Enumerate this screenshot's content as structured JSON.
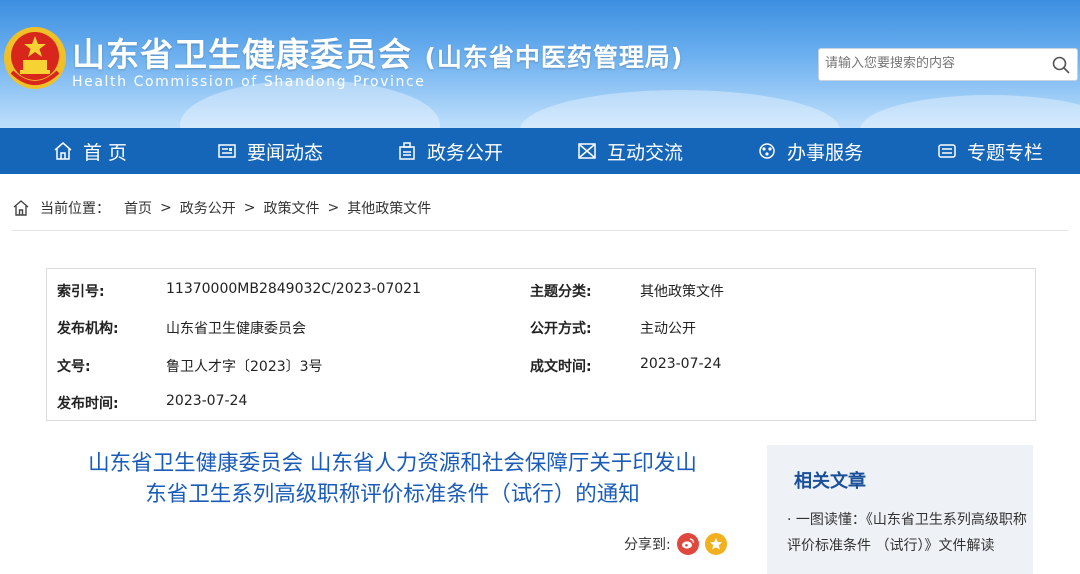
{
  "header": {
    "title": "山东省卫生健康委员会",
    "title_suffix": "(山东省中医药管理局)",
    "subtitle": "Health Commission of Shandong Province",
    "search_placeholder": "请输入您要搜索的内容"
  },
  "nav": {
    "items": [
      {
        "label": "首 页",
        "icon": "home-icon"
      },
      {
        "label": "要闻动态",
        "icon": "news-icon"
      },
      {
        "label": "政务公开",
        "icon": "government-icon"
      },
      {
        "label": "互动交流",
        "icon": "interaction-icon"
      },
      {
        "label": "办事服务",
        "icon": "service-icon"
      },
      {
        "label": "专题专栏",
        "icon": "column-icon"
      }
    ]
  },
  "breadcrumb": {
    "label": "当前位置：",
    "items": [
      "首页",
      "政务公开",
      "政策文件",
      "其他政策文件"
    ],
    "separator": ">"
  },
  "info": {
    "index_label": "索引号:",
    "index_value": "11370000MB2849032C/2023-07021",
    "topic_label": "主题分类:",
    "topic_value": "其他政策文件",
    "org_label": "发布机构:",
    "org_value": "山东省卫生健康委员会",
    "mode_label": "公开方式:",
    "mode_value": "主动公开",
    "doc_label": "文号:",
    "doc_value": "鲁卫人才字〔2023〕3号",
    "made_label": "成文时间:",
    "made_value": "2023-07-24",
    "pub_label": "发布时间:",
    "pub_value": "2023-07-24"
  },
  "article": {
    "title_line1": "山东省卫生健康委员会 山东省人力资源和社会保障厅关于印发山",
    "title_line2": "东省卫生系列高级职称评价标准条件（试行）的通知",
    "share_label": "分享到:"
  },
  "sidebar": {
    "title": "相关文章",
    "item1": "· 一图读懂：《山东省卫生系列高级职称评价标准条件 （试行）》文件解读"
  },
  "colors": {
    "nav_bg": "#1565b8",
    "title_blue": "#1a5cb8",
    "weibo": "#e0483e",
    "favorite": "#f2b01e"
  }
}
